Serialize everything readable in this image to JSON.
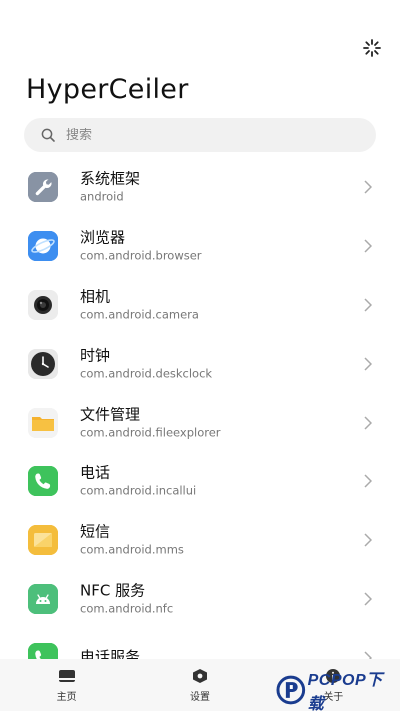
{
  "header": {
    "title": "HyperCeiler"
  },
  "search": {
    "placeholder": "搜索"
  },
  "apps": [
    {
      "name": "系统框架",
      "package": "android",
      "icon": "wrench-icon",
      "color": "#7e8a9c"
    },
    {
      "name": "浏览器",
      "package": "com.android.browser",
      "icon": "planet-icon",
      "color": "#3d8ef0"
    },
    {
      "name": "相机",
      "package": "com.android.camera",
      "icon": "camera-lens-icon",
      "color": "#e9e9e9"
    },
    {
      "name": "时钟",
      "package": "com.android.deskclock",
      "icon": "clock-icon",
      "color": "#2c2c2c"
    },
    {
      "name": "文件管理",
      "package": "com.android.fileexplorer",
      "icon": "folder-icon",
      "color": "#f5b22e"
    },
    {
      "name": "电话",
      "package": "com.android.incallui",
      "icon": "phone-icon",
      "color": "#3ec35c"
    },
    {
      "name": "短信",
      "package": "com.android.mms",
      "icon": "message-icon",
      "color": "#f4bd3c"
    },
    {
      "name": "NFC 服务",
      "package": "com.android.nfc",
      "icon": "android-icon",
      "color": "#4dbf7b"
    },
    {
      "name": "电话服务",
      "package": "",
      "icon": "phone-icon",
      "color": "#3ec35c"
    }
  ],
  "nav": [
    {
      "label": "主页",
      "icon": "home-icon"
    },
    {
      "label": "设置",
      "icon": "settings-icon"
    },
    {
      "label": "关于",
      "icon": "info-icon"
    }
  ],
  "watermark": {
    "text": "PCPOP下载"
  }
}
